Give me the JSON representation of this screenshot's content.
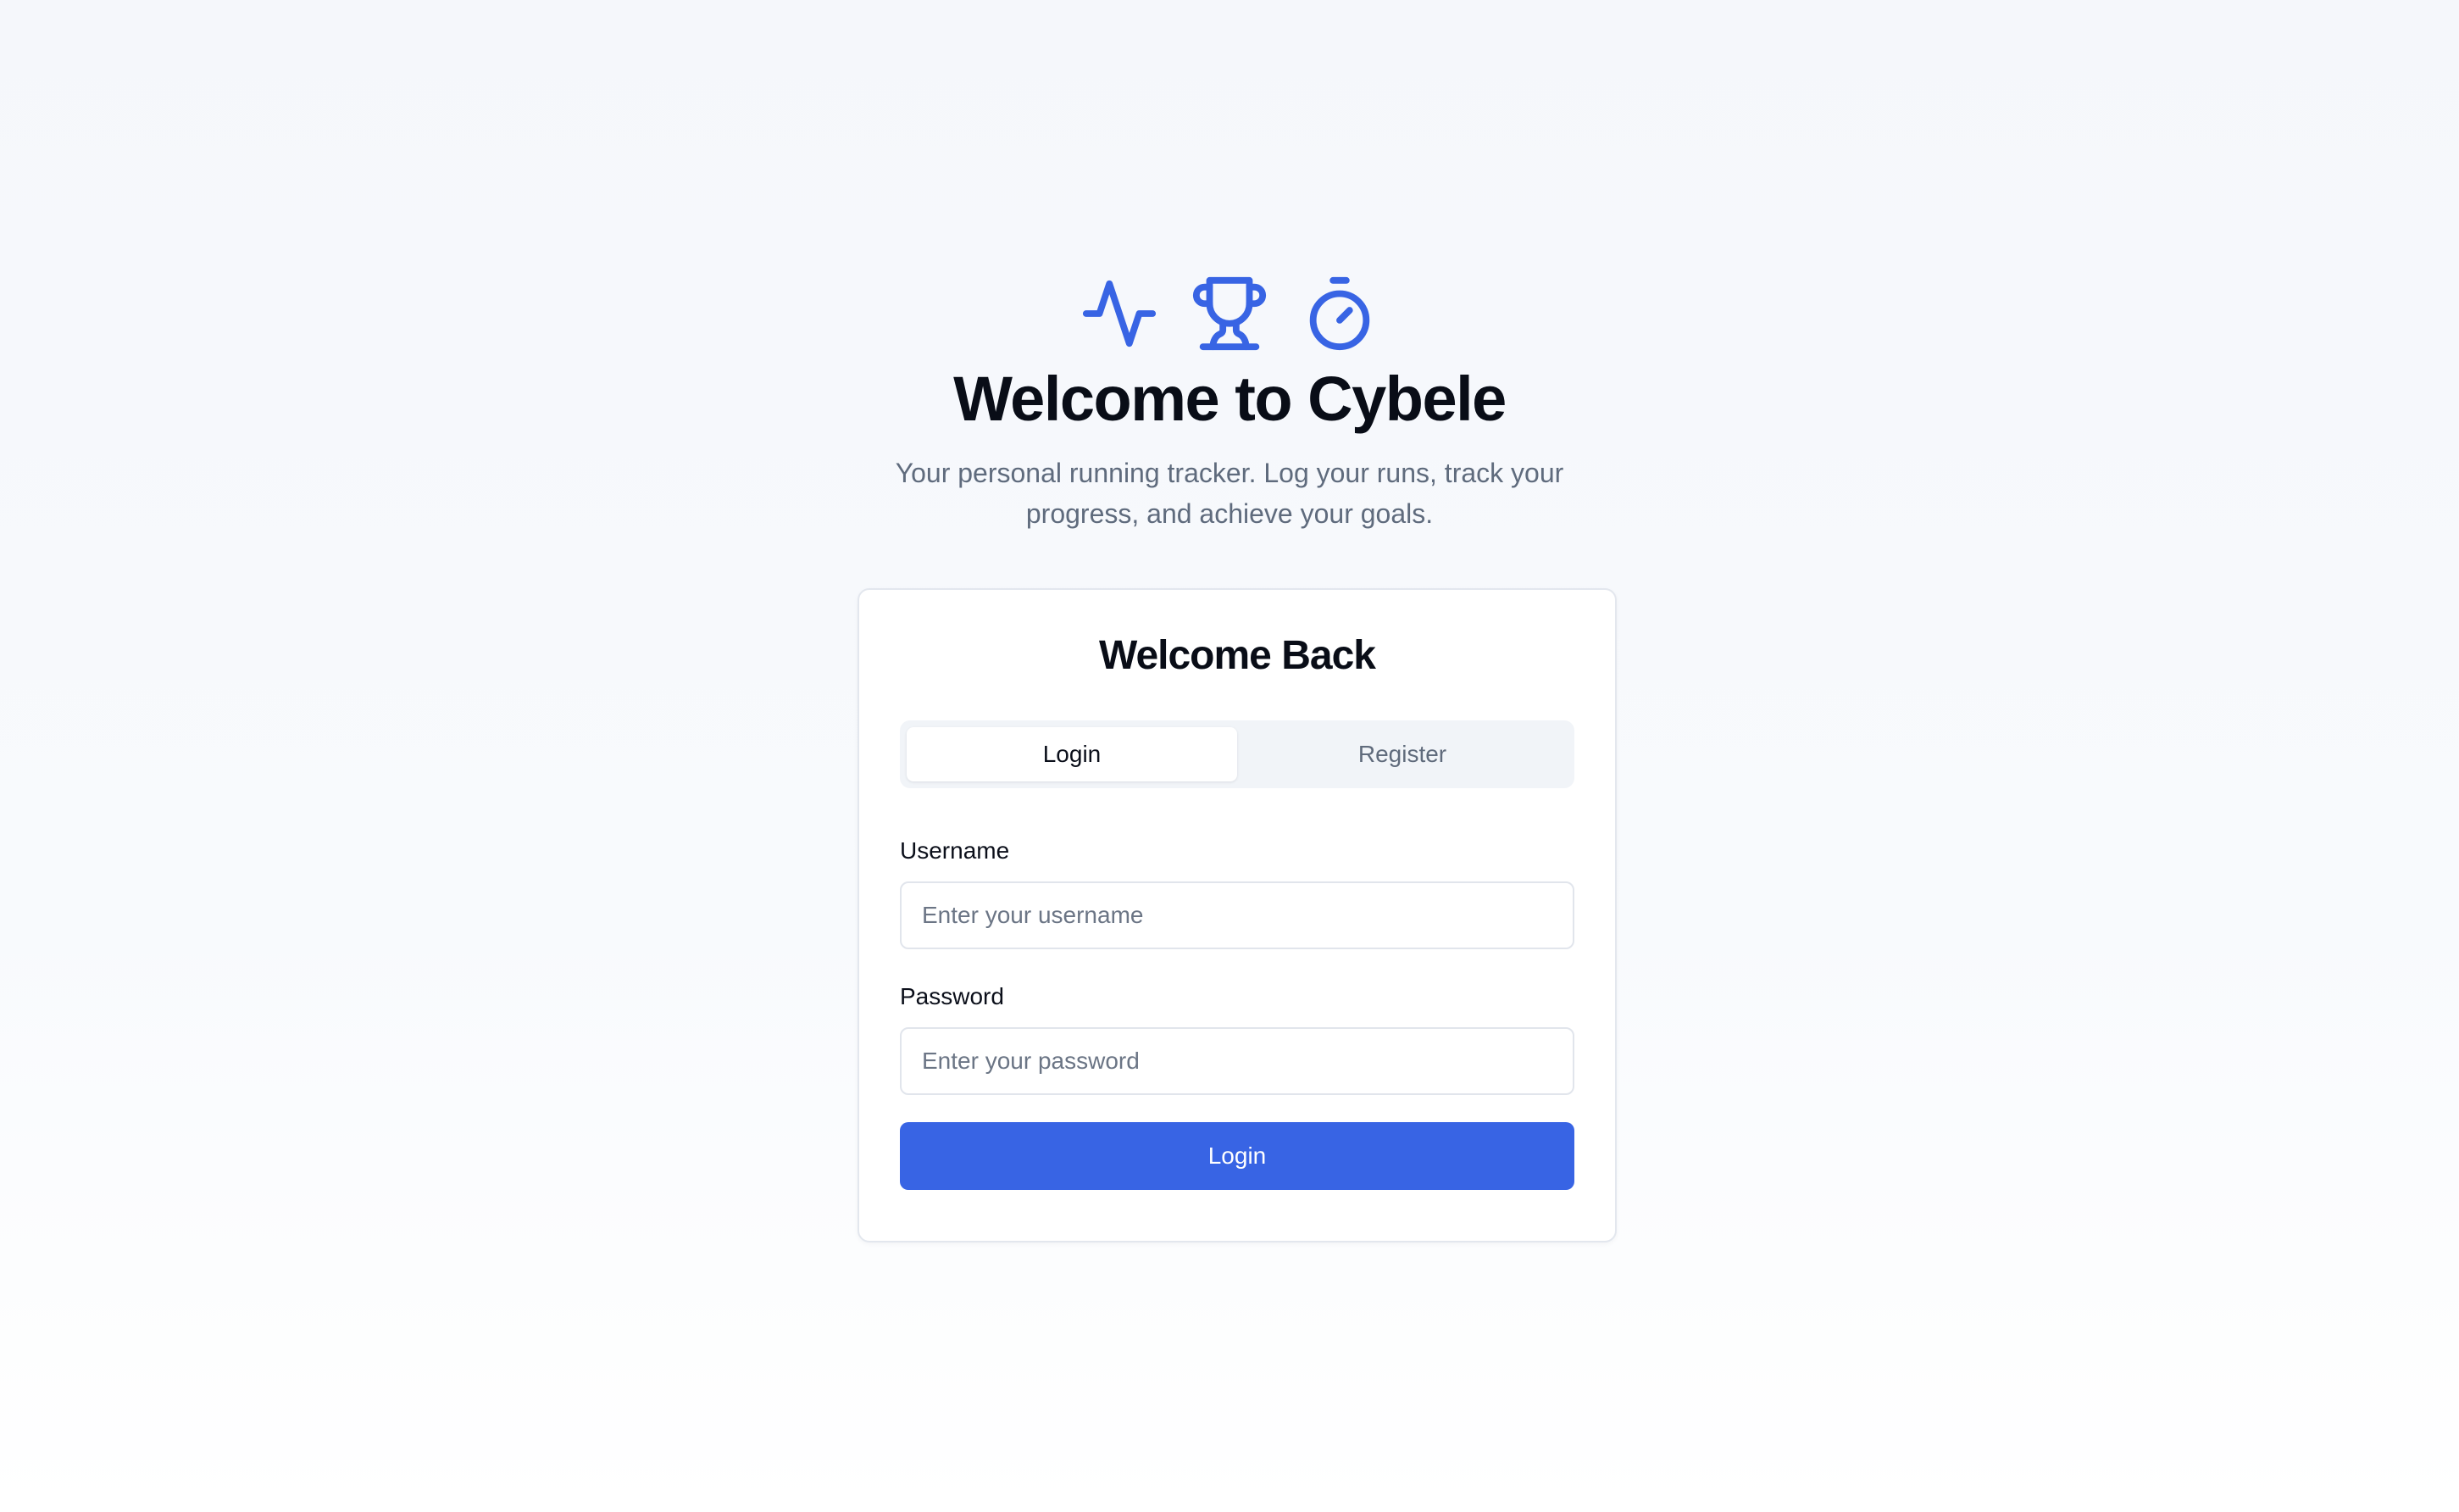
{
  "hero": {
    "icons": [
      "activity-icon",
      "trophy-icon",
      "timer-icon"
    ],
    "icon_color": "#3864e4",
    "title": "Welcome to Cybele",
    "subtitle": "Your personal running tracker. Log your runs, track your progress, and achieve your goals."
  },
  "auth_card": {
    "title": "Welcome Back",
    "tabs": [
      {
        "label": "Login",
        "active": true
      },
      {
        "label": "Register",
        "active": false
      }
    ],
    "username": {
      "label": "Username",
      "placeholder": "Enter your username",
      "value": ""
    },
    "password": {
      "label": "Password",
      "placeholder": "Enter your password",
      "value": ""
    },
    "submit_label": "Login",
    "accent_color": "#3864e4"
  }
}
